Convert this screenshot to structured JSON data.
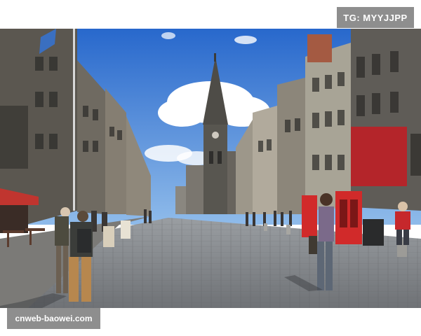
{
  "watermarks": {
    "top_right": "TG: MYYJJPP",
    "bottom_left": "cnweb-baowei.com"
  },
  "scene": {
    "palette": {
      "sky": "#2f78d6",
      "sky_light": "#7fb2ec",
      "cloud": "#ffffff",
      "stone_dark": "#4a4a48",
      "stone_mid": "#6d6a64",
      "stone_light": "#9a958c",
      "cobble": "#8a8e92",
      "phone_box": "#d12a2a",
      "shop_red": "#b4252a"
    }
  }
}
